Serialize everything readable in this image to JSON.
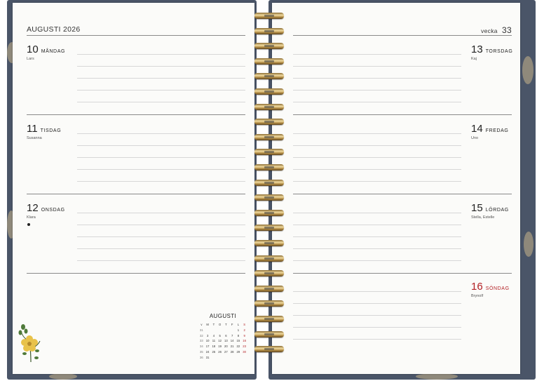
{
  "left_page": {
    "month_year": "AUGUSTI 2026",
    "days": [
      {
        "number": "10",
        "name": "MÅNDAG",
        "name_day": "Lars",
        "has_dot": false
      },
      {
        "number": "11",
        "name": "TISDAG",
        "name_day": "Susanna",
        "has_dot": false
      },
      {
        "number": "12",
        "name": "ONSDAG",
        "name_day": "Klara",
        "has_dot": true
      }
    ]
  },
  "right_page": {
    "week_label": "vecka",
    "week_number": "33",
    "days": [
      {
        "number": "13",
        "name": "TORSDAG",
        "name_day": "Kaj",
        "color": "#222222"
      },
      {
        "number": "14",
        "name": "FREDAG",
        "name_day": "Uno",
        "color": "#222222"
      },
      {
        "number": "15",
        "name": "LÖRDAG",
        "name_day": "Stella, Estelle",
        "color": "#222222"
      },
      {
        "number": "16",
        "name": "SÖNDAG",
        "name_day": "Brynolf",
        "color": "#b32025"
      }
    ]
  },
  "mini_calendar": {
    "title": "AUGUSTI",
    "weekday_headers": [
      "v",
      "M",
      "T",
      "O",
      "T",
      "F",
      "L",
      "S"
    ],
    "rows": [
      [
        "31",
        "",
        "",
        "",
        "",
        "",
        "1",
        "2"
      ],
      [
        "32",
        "3",
        "4",
        "5",
        "6",
        "7",
        "8",
        "9"
      ],
      [
        "33",
        "10",
        "11",
        "12",
        "13",
        "14",
        "15",
        "16"
      ],
      [
        "34",
        "17",
        "18",
        "19",
        "20",
        "21",
        "22",
        "23"
      ],
      [
        "35",
        "24",
        "25",
        "26",
        "27",
        "28",
        "29",
        "30"
      ],
      [
        "36",
        "31",
        "",
        "",
        "",
        "",
        "",
        ""
      ]
    ]
  },
  "colors": {
    "sunday": "#b32025",
    "cover": "#4a5568",
    "ring": "#c9a45c"
  },
  "decoration": {
    "icon": "yellow-flower-icon"
  }
}
